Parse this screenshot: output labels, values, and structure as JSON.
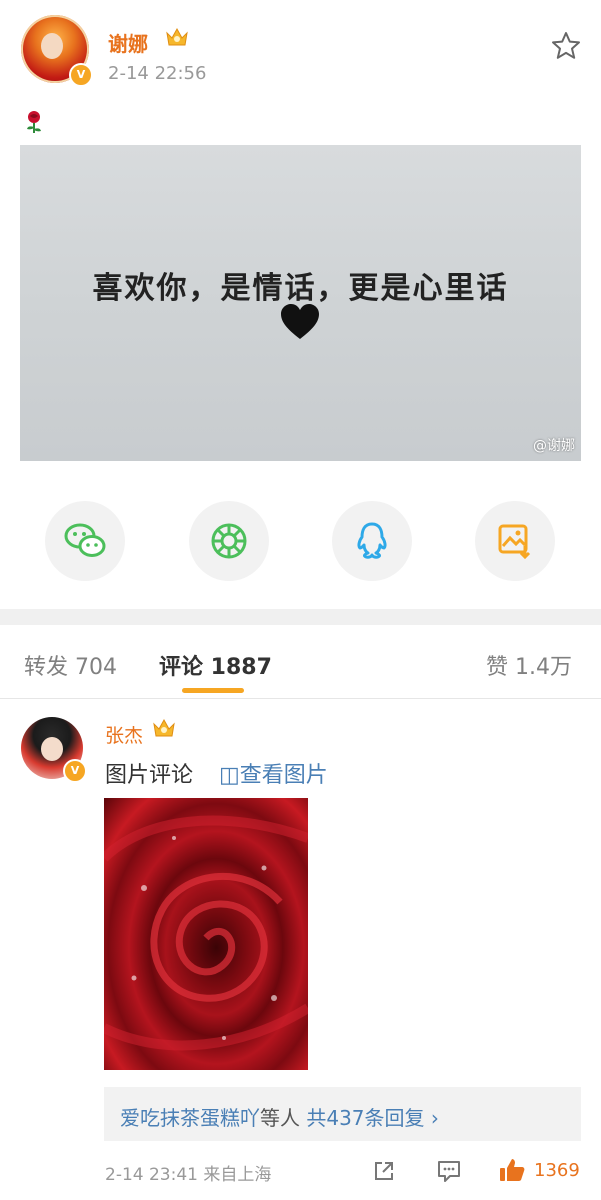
{
  "post": {
    "author": "谢娜",
    "timestamp": "2-14 22:56",
    "text_emoji": "🌹",
    "image_text": "喜欢你，是情话，更是心里话",
    "image_watermark": "@谢娜"
  },
  "share": {
    "items": [
      {
        "name": "wechat-icon",
        "color": "#4cbf5b"
      },
      {
        "name": "moments-icon",
        "color": "#4cbf5b"
      },
      {
        "name": "qq-icon",
        "color": "#2ea9e8"
      },
      {
        "name": "save-image-icon",
        "color": "#f6a623"
      }
    ]
  },
  "tabs": {
    "repost": "转发 704",
    "comments": "评论 1887",
    "likes": "赞 1.4万"
  },
  "comment": {
    "author": "张杰",
    "text": "图片评论",
    "link": "◫查看图片",
    "reply_users": "爱吃抹茶蛋糕吖",
    "reply_mid": "等人",
    "reply_count": "共437条回复 ›",
    "meta": "2-14 23:41  来自上海",
    "like_count": "1369"
  },
  "colors": {
    "accent": "#f6a623",
    "username": "#e8731e",
    "link": "#4a7fb5"
  }
}
